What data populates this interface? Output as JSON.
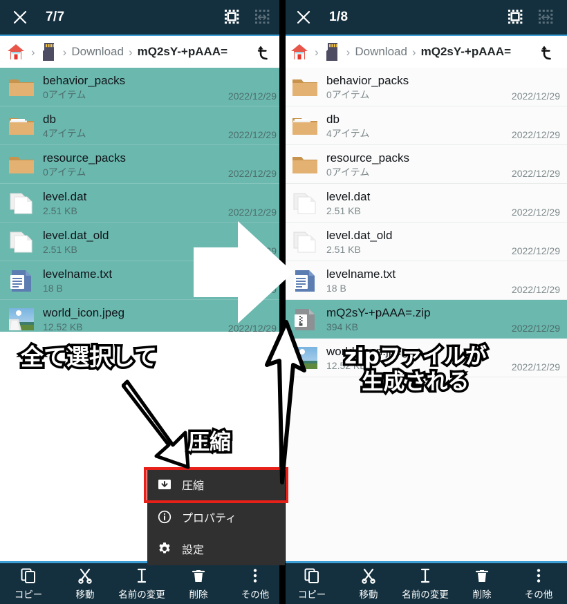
{
  "app": {
    "accent_blue": "#3d9fd6",
    "bar_dark": "#14303f",
    "selection_teal": "#6bb8af",
    "highlight_red": "#e8201a",
    "menu_dark": "#303030"
  },
  "left_panel": {
    "actionbar": {
      "close_icon": "close-icon",
      "count": "7/7",
      "select_all_icon": "select-all-icon",
      "select_range_icon": "select-range-icon"
    },
    "breadcrumb": {
      "home_icon": "home-icon",
      "sdcard_icon": "sdcard-icon",
      "separator": "›",
      "segments": [
        "Download",
        "mQ2sY-+pAAA="
      ],
      "up_icon": "go-up-icon"
    },
    "files": [
      {
        "icon": "folder-icon",
        "name": "behavior_packs",
        "sub": "0アイテム",
        "date": "2022/12/29",
        "selected": true
      },
      {
        "icon": "folder-full-icon",
        "name": "db",
        "sub": "4アイテム",
        "date": "2022/12/29",
        "selected": true
      },
      {
        "icon": "folder-icon",
        "name": "resource_packs",
        "sub": "0アイテム",
        "date": "2022/12/29",
        "selected": true
      },
      {
        "icon": "file-blank-icon",
        "name": "level.dat",
        "sub": "2.51 KB",
        "date": "2022/12/29",
        "selected": true
      },
      {
        "icon": "file-blank-icon",
        "name": "level.dat_old",
        "sub": "2.51 KB",
        "date": "2022/12/29",
        "selected": true
      },
      {
        "icon": "file-text-icon",
        "name": "levelname.txt",
        "sub": "18 B",
        "date": "2022/12/29",
        "selected": true
      },
      {
        "icon": "image-thumb-icon",
        "name": "world_icon.jpeg",
        "sub": "12.52 KB",
        "date": "2022/12/29",
        "selected": true
      }
    ],
    "context_menu": [
      {
        "icon": "archive-icon",
        "label": "圧縮",
        "highlighted": true
      },
      {
        "icon": "info-icon",
        "label": "プロパティ",
        "highlighted": false
      },
      {
        "icon": "gear-icon",
        "label": "設定",
        "highlighted": false
      }
    ],
    "bottombar": [
      {
        "icon": "copy-icon",
        "label": "コピー"
      },
      {
        "icon": "cut-icon",
        "label": "移動"
      },
      {
        "icon": "rename-icon",
        "label": "名前の変更"
      },
      {
        "icon": "trash-icon",
        "label": "削除"
      },
      {
        "icon": "more-icon",
        "label": "その他"
      }
    ]
  },
  "right_panel": {
    "actionbar": {
      "close_icon": "close-icon",
      "count": "1/8",
      "select_all_icon": "select-all-icon",
      "select_range_icon": "select-range-icon"
    },
    "breadcrumb": {
      "home_icon": "home-icon",
      "sdcard_icon": "sdcard-icon",
      "separator": "›",
      "segments": [
        "Download",
        "mQ2sY-+pAAA="
      ],
      "up_icon": "go-up-icon"
    },
    "files": [
      {
        "icon": "folder-icon",
        "name": "behavior_packs",
        "sub": "0アイテム",
        "date": "2022/12/29",
        "selected": false
      },
      {
        "icon": "folder-full-icon",
        "name": "db",
        "sub": "4アイテム",
        "date": "2022/12/29",
        "selected": false
      },
      {
        "icon": "folder-icon",
        "name": "resource_packs",
        "sub": "0アイテム",
        "date": "2022/12/29",
        "selected": false
      },
      {
        "icon": "file-blank-icon",
        "name": "level.dat",
        "sub": "2.51 KB",
        "date": "2022/12/29",
        "selected": false
      },
      {
        "icon": "file-blank-icon",
        "name": "level.dat_old",
        "sub": "2.51 KB",
        "date": "2022/12/29",
        "selected": false
      },
      {
        "icon": "file-text-icon",
        "name": "levelname.txt",
        "sub": "18 B",
        "date": "2022/12/29",
        "selected": false
      },
      {
        "icon": "file-zip-icon",
        "name": "mQ2sY-+pAAA=.zip",
        "sub": "394 KB",
        "date": "2022/12/29",
        "selected": true
      },
      {
        "icon": "image-thumb-icon",
        "name": "world_icon.jpeg",
        "sub": "12.52 KB",
        "date": "2022/12/29",
        "selected": false
      }
    ],
    "bottombar": [
      {
        "icon": "copy-icon",
        "label": "コピー"
      },
      {
        "icon": "cut-icon",
        "label": "移動"
      },
      {
        "icon": "rename-icon",
        "label": "名前の変更"
      },
      {
        "icon": "trash-icon",
        "label": "削除"
      },
      {
        "icon": "more-icon",
        "label": "その他"
      }
    ]
  },
  "annotations": {
    "left_step": "全て選択して",
    "left_action": "圧縮",
    "right_result_line1": "zipファイルが",
    "right_result_line2": "生成される"
  }
}
